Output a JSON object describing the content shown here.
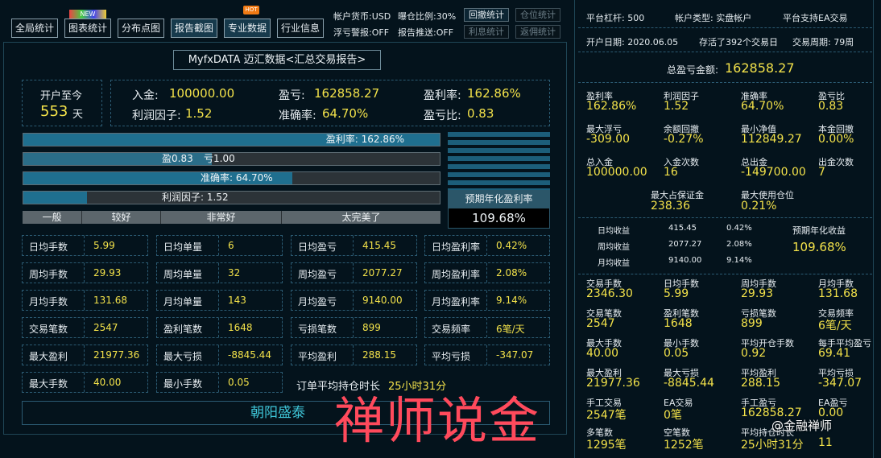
{
  "toolbar": {
    "tabs": [
      "全局统计",
      "图表统计",
      "分布点图",
      "报告截图",
      "专业数据",
      "行业信息"
    ],
    "badge_new": "NEW",
    "badge_hot": "HOT",
    "info": {
      "currency": "帐户货币:USD",
      "ratio": "曝仓比例:30%",
      "float_warn": "浮亏警报:OFF",
      "push": "报告推送:OFF"
    },
    "buttons": [
      "回撤统计",
      "仓位统计",
      "利息统计",
      "返佣统计"
    ]
  },
  "report_title": "MyfxDATA 迈汇数据<汇总交易报告>",
  "open": {
    "label": "开户至今",
    "days": "553",
    "unit": "天"
  },
  "summary": [
    {
      "label": "入金:",
      "value": "100000.00"
    },
    {
      "label": "盈亏:",
      "value": "162858.27"
    },
    {
      "label": "盈利率:",
      "value": "162.86%"
    },
    {
      "label": "利润因子:",
      "value": "1.52"
    },
    {
      "label": "准确率:",
      "value": "64.70%"
    },
    {
      "label": "盈亏比:",
      "value": "0.83"
    }
  ],
  "bars": {
    "profit_rate": "盈利率: 162.86%",
    "profit_rate_fill": 1.0,
    "win": "盈0.83",
    "loss": "亏1.00",
    "win_fill": 0.4535,
    "accuracy": "准确率: 64.70%",
    "accuracy_fill": 0.647,
    "pf": "利润因子: 1.52",
    "pf_fill": 0.152,
    "scale": [
      "一般",
      "较好",
      "非常好",
      "太完美了"
    ]
  },
  "annual": {
    "label": "预期年化盈利率",
    "value": "109.68%"
  },
  "grid": [
    [
      {
        "l": "日均手数",
        "v": "5.99"
      },
      {
        "l": "日均单量",
        "v": "6"
      },
      {
        "l": "日均盈亏",
        "v": "415.45"
      },
      {
        "l": "日均盈利率",
        "v": "0.42%"
      }
    ],
    [
      {
        "l": "周均手数",
        "v": "29.93"
      },
      {
        "l": "周均单量",
        "v": "32"
      },
      {
        "l": "周均盈亏",
        "v": "2077.27"
      },
      {
        "l": "周均盈利率",
        "v": "2.08%"
      }
    ],
    [
      {
        "l": "月均手数",
        "v": "131.68"
      },
      {
        "l": "月均单量",
        "v": "143"
      },
      {
        "l": "月均盈亏",
        "v": "9140.00"
      },
      {
        "l": "月均盈利率",
        "v": "9.14%"
      }
    ],
    [
      {
        "l": "交易笔数",
        "v": "2547"
      },
      {
        "l": "盈利笔数",
        "v": "1648"
      },
      {
        "l": "亏损笔数",
        "v": "899"
      },
      {
        "l": "交易频率",
        "v": "6笔/天"
      }
    ],
    [
      {
        "l": "最大盈利",
        "v": "21977.36"
      },
      {
        "l": "最大亏损",
        "v": "-8845.44"
      },
      {
        "l": "平均盈利",
        "v": "288.15"
      },
      {
        "l": "平均亏损",
        "v": "-347.07"
      }
    ],
    [
      {
        "l": "最大手数",
        "v": "40.00"
      },
      {
        "l": "最小手数",
        "v": "0.05"
      }
    ]
  ],
  "hold": {
    "label": "订单平均持仓时长",
    "value": "25小时31分"
  },
  "company": "朝阳盛泰",
  "watermark": "禅师说金",
  "weibo": "@金融禅师",
  "right": {
    "leverage": "平台杠杆: 500",
    "acct_type": "帐户类型: 实盘帐户",
    "ea": "平台支持EA交易",
    "open_date": "开户日期: 2020.06.05",
    "alive": "存活了392个交易日",
    "cycle": "交易周期: 79周",
    "total_label": "总盈亏金额:",
    "total_value": "162858.27",
    "r1": [
      {
        "l": "盈利率",
        "v": "162.86%"
      },
      {
        "l": "利润因子",
        "v": "1.52"
      },
      {
        "l": "准确率",
        "v": "64.70%"
      },
      {
        "l": "盈亏比",
        "v": "0.83"
      }
    ],
    "r2": [
      {
        "l": "最大浮亏",
        "v": "-309.00"
      },
      {
        "l": "余额回撤",
        "v": "-0.27%"
      },
      {
        "l": "最小净值",
        "v": "112849.27"
      },
      {
        "l": "本金回撤",
        "v": "0.00%"
      }
    ],
    "r3": [
      {
        "l": "总入金",
        "v": "100000.00"
      },
      {
        "l": "入金次数",
        "v": "16"
      },
      {
        "l": "总出金",
        "v": "-149700.00"
      },
      {
        "l": "出金次数",
        "v": "7"
      }
    ],
    "r4": [
      {
        "l": "最大占保证金",
        "v": "238.36"
      },
      {
        "l": "最大使用仓位",
        "v": "0.21%"
      }
    ],
    "avg": [
      {
        "l": "日均收益",
        "a": "415.45",
        "b": "0.42%"
      },
      {
        "l": "周均收益",
        "a": "2077.27",
        "b": "2.08%"
      },
      {
        "l": "月均收益",
        "a": "9140.00",
        "b": "9.14%"
      }
    ],
    "annual_label": "预期年化收益",
    "annual_value": "109.68%",
    "r5": [
      {
        "l": "交易手数",
        "v": "2346.30"
      },
      {
        "l": "日均手数",
        "v": "5.99"
      },
      {
        "l": "周均手数",
        "v": "29.93"
      },
      {
        "l": "月均手数",
        "v": "131.68"
      }
    ],
    "r6": [
      {
        "l": "交易笔数",
        "v": "2547"
      },
      {
        "l": "盈利笔数",
        "v": "1648"
      },
      {
        "l": "亏损笔数",
        "v": "899"
      },
      {
        "l": "交易频率",
        "v": "6笔/天"
      }
    ],
    "r7": [
      {
        "l": "最大手数",
        "v": "40.00"
      },
      {
        "l": "最小手数",
        "v": "0.05"
      },
      {
        "l": "平均开仓手数",
        "v": "0.92"
      },
      {
        "l": "每手平均盈亏",
        "v": "69.41"
      }
    ],
    "r8": [
      {
        "l": "最大盈利",
        "v": "21977.36"
      },
      {
        "l": "最大亏损",
        "v": "-8845.44"
      },
      {
        "l": "平均盈利",
        "v": "288.15"
      },
      {
        "l": "平均亏损",
        "v": "-347.07"
      }
    ],
    "r9": [
      {
        "l": "手工交易",
        "v": "2547笔"
      },
      {
        "l": "EA交易",
        "v": "0笔"
      },
      {
        "l": "手工盈亏",
        "v": "162858.27"
      },
      {
        "l": "EA盈亏",
        "v": "0.00"
      }
    ],
    "r10": [
      {
        "l": "多笔数",
        "v": "1295笔"
      },
      {
        "l": "空笔数",
        "v": "1252笔"
      },
      {
        "l": "平均持仓时长",
        "v": "25小时31分"
      },
      {
        "l": "",
        "v": "11"
      }
    ]
  }
}
